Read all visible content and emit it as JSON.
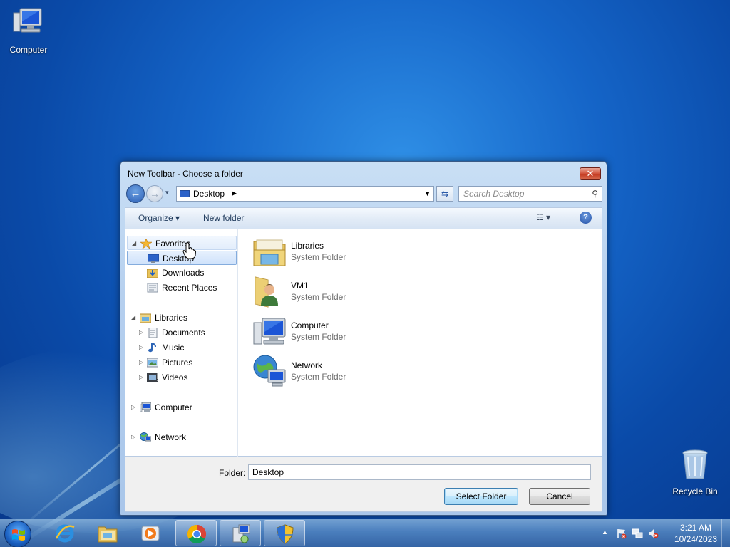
{
  "desktop": {
    "computer_label": "Computer",
    "recycle_label": "Recycle Bin"
  },
  "dialog": {
    "title": "New Toolbar - Choose a folder",
    "close_glyph": "✕",
    "address": "Desktop",
    "search_placeholder": "Search Desktop",
    "toolbar": {
      "organize": "Organize ▾",
      "new_folder": "New folder",
      "help": "?"
    },
    "nav": {
      "favorites": "Favorites",
      "desktop": "Desktop",
      "downloads": "Downloads",
      "recent_places": "Recent Places",
      "libraries": "Libraries",
      "documents": "Documents",
      "music": "Music",
      "pictures": "Pictures",
      "videos": "Videos",
      "computer": "Computer",
      "network": "Network"
    },
    "items": [
      {
        "name": "Libraries",
        "type": "System Folder",
        "icon": "libraries-icon"
      },
      {
        "name": "VM1",
        "type": "System Folder",
        "icon": "user-folder-icon"
      },
      {
        "name": "Computer",
        "type": "System Folder",
        "icon": "computer-icon"
      },
      {
        "name": "Network",
        "type": "System Folder",
        "icon": "network-icon"
      }
    ],
    "folder_label": "Folder:",
    "folder_value": "Desktop",
    "select_button": "Select Folder",
    "cancel_button": "Cancel"
  },
  "taskbar": {
    "apps": [
      "internet-explorer-icon",
      "explorer-folder-icon",
      "media-player-icon",
      "chrome-icon",
      "installer-icon",
      "security-shield-icon"
    ],
    "time": "3:21 AM",
    "date": "10/24/2023"
  },
  "colors": {
    "accent": "#3c7fb1",
    "wallpaper": "#1565c8",
    "selection": "#cfe2fb"
  }
}
